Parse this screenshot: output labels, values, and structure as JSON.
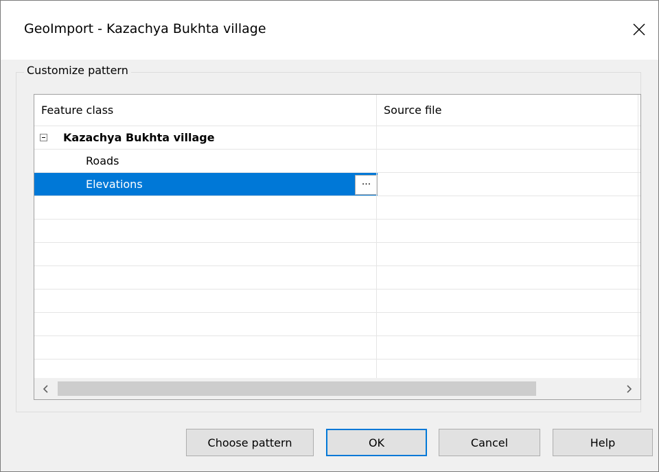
{
  "window": {
    "title": "GeoImport - Kazachya Bukhta village",
    "close_icon": "close-icon"
  },
  "group": {
    "legend": "Customize pattern"
  },
  "grid": {
    "columns": [
      "Feature class",
      "Source file"
    ],
    "rows": [
      {
        "feature_class": "Kazachya Bukhta village",
        "source_file": "",
        "level": 0,
        "expanded": true,
        "bold": true,
        "selected": false
      },
      {
        "feature_class": "Roads",
        "source_file": "",
        "level": 1,
        "bold": false,
        "selected": false
      },
      {
        "feature_class": "Elevations",
        "source_file": "",
        "level": 1,
        "bold": false,
        "selected": true,
        "ellipsis_label": "..."
      }
    ],
    "selection_color": "#0078d7"
  },
  "buttons": {
    "choose_pattern": "Choose pattern",
    "ok": "OK",
    "cancel": "Cancel",
    "help": "Help"
  },
  "colors": {
    "accent": "#0078d7",
    "dialog_bg": "#f0f0f0",
    "button_bg": "#e1e1e1"
  }
}
